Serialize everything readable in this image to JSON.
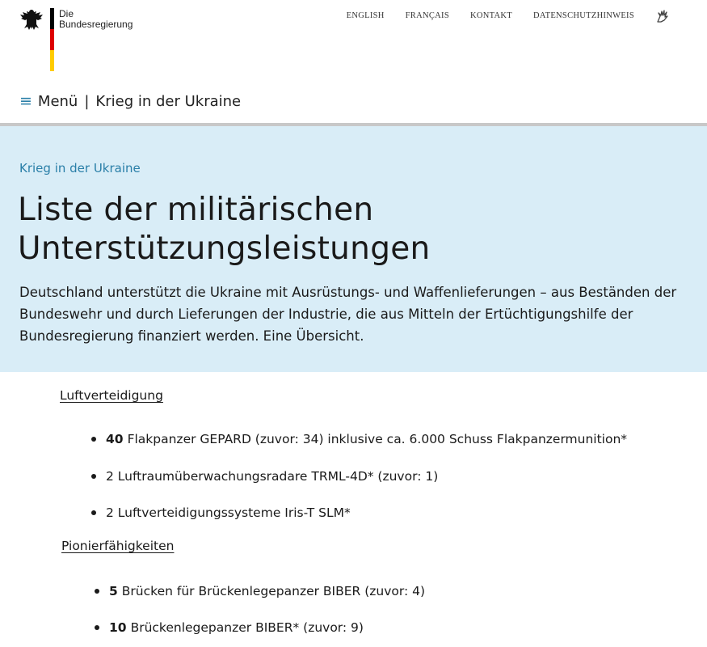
{
  "header": {
    "logo": {
      "line1": "Die",
      "line2": "Bundesregierung"
    },
    "nav": [
      "ENGLISH",
      "FRANÇAIS",
      "KONTAKT",
      "DATENSCHUTZHINWEIS"
    ],
    "menu_label": "Menü",
    "current_section": "Krieg in der Ukraine"
  },
  "hero": {
    "breadcrumb": "Krieg in der Ukraine",
    "title_line1": "Liste der militärischen",
    "title_line2": "Unterstützungsleistungen",
    "intro": "Deutschland unterstützt die Ukraine mit Ausrüstungs- und Waffenlieferungen – aus Beständen der Bundeswehr und durch Lieferungen der Industrie, die aus Mitteln der Ertüchtigungshilfe der Bundesregierung finanziert werden. Eine Übersicht."
  },
  "sections": [
    {
      "heading": "Luftverteidigung",
      "items": [
        {
          "bold": "40",
          "text": "Flakpanzer GEPARD (zuvor: 34) inklusive ca. 6.000 Schuss Flakpanzermunition*"
        },
        {
          "bold": "",
          "text": "2 Luftraumüberwachungsradare TRML-4D* (zuvor: 1)"
        },
        {
          "bold": "",
          "text": "2 Luftverteidigungssysteme Iris-T SLM*"
        }
      ]
    },
    {
      "heading": "Pionierfähigkeiten",
      "items": [
        {
          "bold": "5",
          "text": "Brücken für Brückenlegepanzer BIBER (zuvor: 4)"
        },
        {
          "bold": "10",
          "text": "Brückenlegepanzer BIBER* (zuvor: 9)"
        }
      ]
    }
  ],
  "icons": {
    "logo": "federal-eagle-icon",
    "accessibility": "sign-language-icon",
    "menu": "hamburger-icon"
  },
  "colors": {
    "accent": "#2a7fa8",
    "hero_bg": "#d9edf7",
    "flag_black": "#000000",
    "flag_red": "#dd0000",
    "flag_gold": "#ffcc00"
  }
}
